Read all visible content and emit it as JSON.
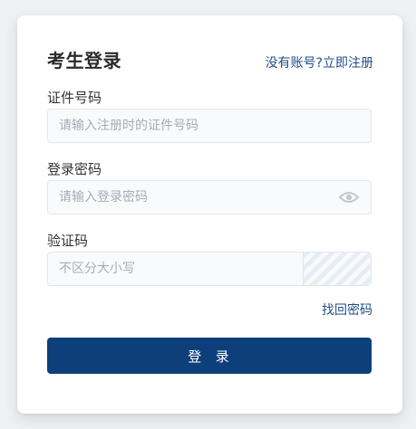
{
  "login": {
    "title": "考生登录",
    "register_link": "没有账号?立即注册",
    "fields": {
      "id_number": {
        "label": "证件号码",
        "placeholder": "请输入注册时的证件号码"
      },
      "password": {
        "label": "登录密码",
        "placeholder": "请输入登录密码",
        "toggle_icon": "eye-icon"
      },
      "captcha": {
        "label": "验证码",
        "placeholder": "不区分大小写"
      }
    },
    "forgot_link": "找回密码",
    "submit_label": "登  录"
  },
  "colors": {
    "brand": "#0d3f7a",
    "link": "#1f4f86",
    "input_bg": "#f8fafc",
    "input_border": "#e2e6ec",
    "page_bg": "#eef0f3"
  }
}
